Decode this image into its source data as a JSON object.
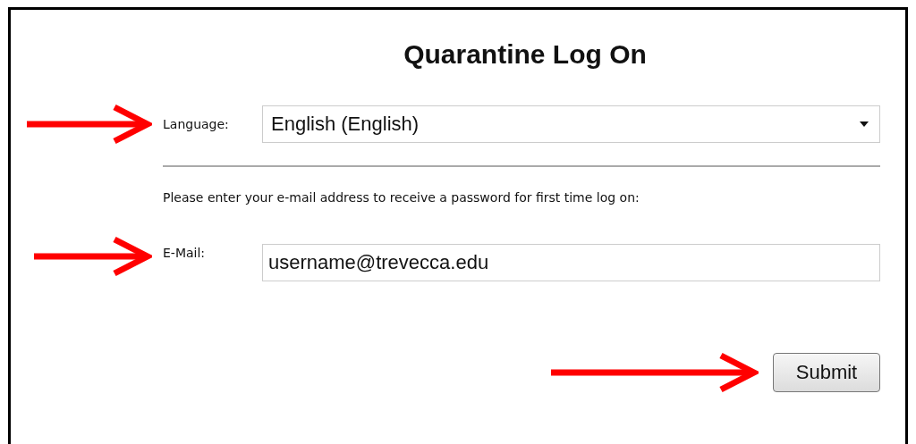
{
  "title": "Quarantine Log On",
  "language": {
    "label": "Language:",
    "value": "English (English)"
  },
  "instruction": "Please enter your e-mail address to receive a password for first time log on:",
  "email": {
    "label": "E-Mail:",
    "value": "username@trevecca.edu"
  },
  "submit": "Submit"
}
